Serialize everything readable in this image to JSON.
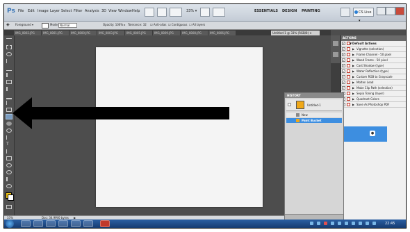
{
  "app": {
    "logo": "Ps",
    "menu": [
      "File",
      "Edit",
      "Image",
      "Layer",
      "Select",
      "Filter",
      "Analysis",
      "3D",
      "View",
      "Window",
      "Help"
    ],
    "zoom": "33% ▾",
    "workspaces": [
      "ESSENTIALS",
      "DESIGN",
      "PAINTING"
    ],
    "cs_live": "CS Live ▾"
  },
  "options": {
    "preset": "Foreground ▾",
    "mode_label": "Mode:",
    "mode_value": "Normal",
    "opacity": "Opacity: 100% ▸",
    "tolerance": "Tolerance: 32",
    "anti_alias": "☑ Anti-alias",
    "contiguous": "☑ Contiguous",
    "all_layers": "☐ All layers"
  },
  "doc_tabs": [
    "IMG_0802.JPG",
    "IMG_0801.JPG",
    "IMG_0800.JPG",
    "IMG_0803.JPG",
    "IMG_0805.JPG",
    "IMG_0809.JPG",
    "IMG_0808.JPG",
    "IMG_0806.JPG",
    "Untitled-1 @ 33% (RGB/8) ×"
  ],
  "status": {
    "zoom": "33%",
    "doc": "Doc: 34.9M/0 bytes"
  },
  "actions_panel": {
    "tab": "ACTIONS",
    "items": [
      {
        "label": "Default Actions",
        "folder": true
      },
      {
        "label": "Vignette (selection)"
      },
      {
        "label": "Frame Channel - 50 pixel"
      },
      {
        "label": "Wood Frame - 50 pixel"
      },
      {
        "label": "Cast Shadow (type)"
      },
      {
        "label": "Water Reflection (type)"
      },
      {
        "label": "Custom RGB to Grayscale"
      },
      {
        "label": "Molten Lead"
      },
      {
        "label": "Make Clip Path (selection)"
      },
      {
        "label": "Sepia Toning (layer)"
      },
      {
        "label": "Quadrant Colors"
      },
      {
        "label": "Save As Photoshop PDF"
      }
    ]
  },
  "history_panel": {
    "title": "HISTORY",
    "snapshot": "Untitled-1",
    "steps": [
      "New",
      "Paint Bucket"
    ]
  },
  "taskbar": {
    "clock": "22:45"
  },
  "colors": {
    "foreground": "#f0c419",
    "selection": "#3d8ee0",
    "annotation_arrow": "#000000"
  }
}
